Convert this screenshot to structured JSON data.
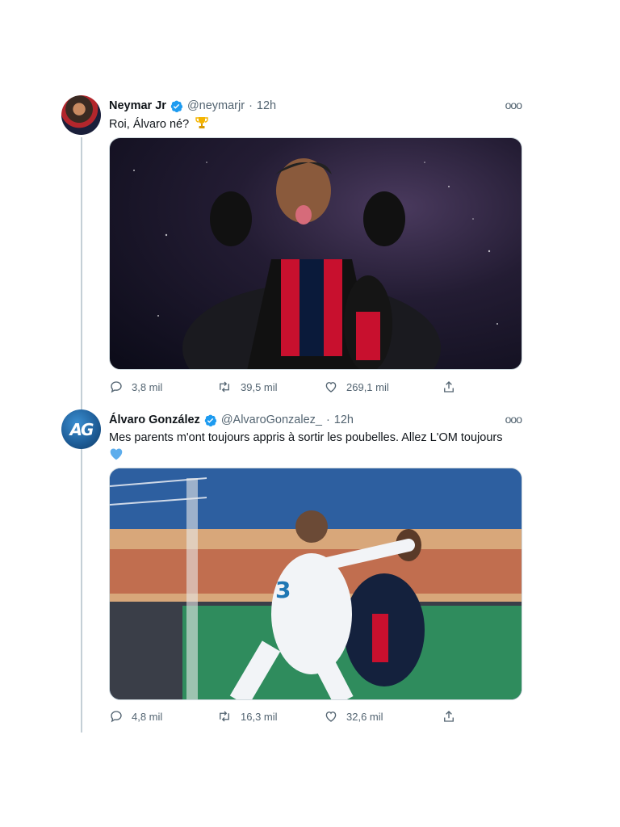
{
  "tweets": [
    {
      "author_name": "Neymar Jr",
      "handle": "@neymarjr",
      "separator": "·",
      "time": "12h",
      "text": "Roi, Álvaro né?",
      "replies": "3,8 mil",
      "retweets": "39,5 mil",
      "likes": "269,1 mil",
      "more_label": "ooo"
    },
    {
      "author_name": "Álvaro González",
      "avatar_initials": "AG",
      "handle": "@AlvaroGonzalez_",
      "separator": "·",
      "time": "12h",
      "text": "Mes parents m'ont toujours appris à sortir les poubelles. Allez L'OM toujours",
      "replies": "4,8 mil",
      "retweets": "16,3 mil",
      "likes": "32,6 mil",
      "more_label": "ooo"
    }
  ],
  "colors": {
    "verified": "#1d9bf0",
    "meta_text": "#536471",
    "thread_line": "#c4cfd6",
    "heart_emoji": "#5dadec"
  },
  "icons": [
    "verified-badge-icon",
    "trophy-emoji-icon",
    "blue-heart-emoji-icon",
    "reply-icon",
    "retweet-icon",
    "like-icon",
    "share-icon",
    "more-icon"
  ]
}
